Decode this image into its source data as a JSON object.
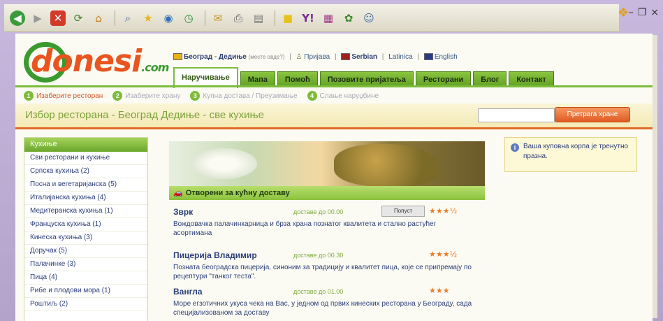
{
  "browser": {
    "toolbar_icons": [
      "back-icon",
      "forward-icon",
      "stop-icon",
      "refresh-icon",
      "home-icon",
      "search-icon",
      "favorites-icon",
      "media-icon",
      "history-icon",
      "mail-icon",
      "print-icon",
      "edit-icon",
      "discuss-icon",
      "messenger-icon",
      "yahoo-icon",
      "research-icon",
      "msn-icon",
      "extra-icon"
    ],
    "window_controls": [
      "–",
      "❐",
      "×"
    ]
  },
  "site": {
    "logo_text": "donesi",
    "logo_suffix": ".com"
  },
  "topline": {
    "location": "Београд - Дедиње",
    "location_note": "(месте овде?)",
    "login": "Пријава",
    "lang_serbian": "Serbian",
    "lang_latinica": "Latinica",
    "lang_english": "English"
  },
  "tabs": [
    "Наручивање",
    "Мапа",
    "Помоћ",
    "Позовите пријатеља",
    "Ресторани",
    "Блог",
    "Контакт"
  ],
  "steps": [
    {
      "num": "1",
      "label": "Изаберите ресторан"
    },
    {
      "num": "2",
      "label": "Изаберите храну"
    },
    {
      "num": "3",
      "label": "Купна достава / Преузимање"
    },
    {
      "num": "4",
      "label": "Слање наруџбине"
    }
  ],
  "titlebar": {
    "title": "Избор ресторана - Београд Дедиње - све кухиње",
    "search_placeholder": "",
    "search_button": "Претрага хране"
  },
  "sidebar": {
    "heading": "Кухиње",
    "items": [
      "Сви ресторани и кухиње",
      "Српска кухиња (2)",
      "Посна и вегетаријанска (5)",
      "Италијанска кухиња (4)",
      "Медитеранска кухиња (1)",
      "Француска кухиња (1)",
      "Кинеска кухиња (3)",
      "Доручак (5)",
      "Палачинке (3)",
      "Пица (4)",
      "Рибе и плодови мора (1)",
      "Роштиљ (2)"
    ]
  },
  "section": {
    "heading": "Отворени за кућну доставу"
  },
  "restaurants": [
    {
      "name": "Зврк",
      "delivery": "доставе до 00.00",
      "button": "Попуст",
      "stars": "★★★½",
      "desc": "Вождовачка палачинкарница и брза храна познатог квалитета и стално растућег асортимана"
    },
    {
      "name": "Пицерија Владимир",
      "delivery": "доставе до 00.30",
      "button": "",
      "stars": "★★★½",
      "desc": "Позната београдска пицерија, синоним за традицију и квалитет пица, које се припремају по рецептури \"танког теста\"."
    },
    {
      "name": "Вангла",
      "delivery": "доставе до 01.00",
      "button": "",
      "stars": "★★★",
      "desc": "Море егзотичних укуса чека на Вас, у једном од првих кинеских ресторана у Београду, сада специјализованом за доставу"
    }
  ],
  "cart": {
    "text": "Ваша куповна корпа је тренутно празна."
  }
}
